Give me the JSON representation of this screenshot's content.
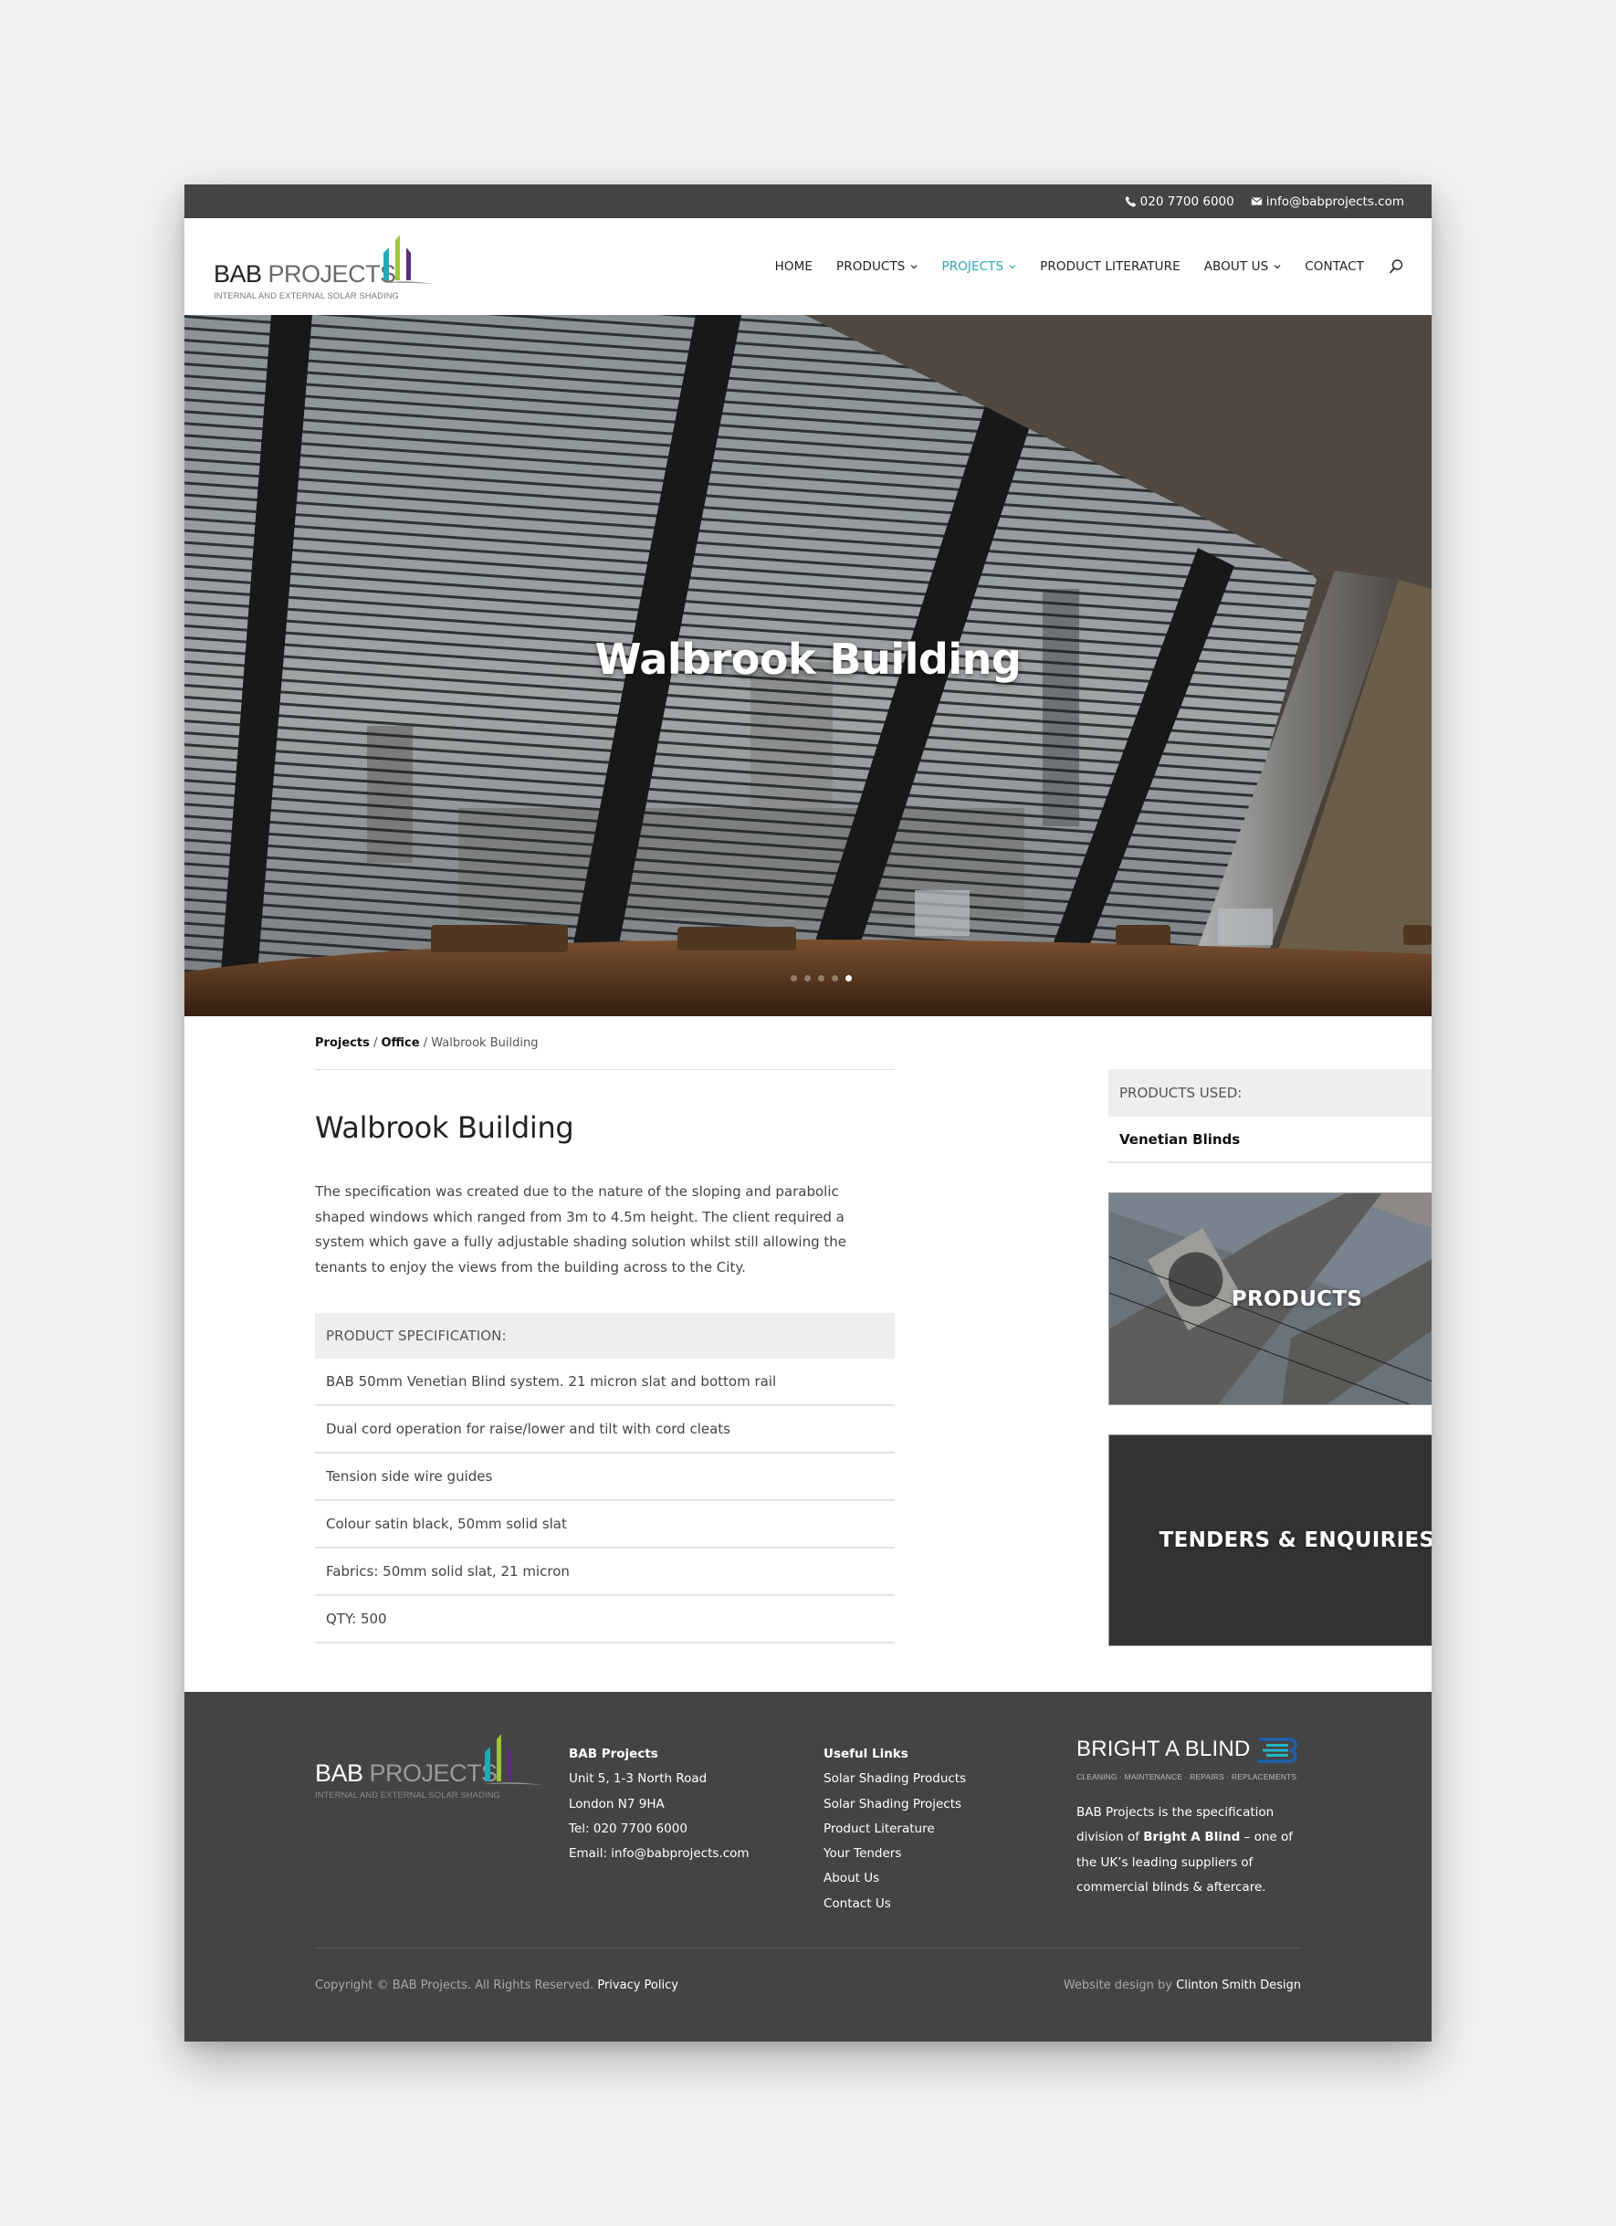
{
  "topbar": {
    "phone": "020 7700 6000",
    "email": "info@babprojects.com",
    "phone_icon": "phone-icon",
    "email_icon": "envelope-icon"
  },
  "logo": {
    "word_bab": "BAB",
    "word_projects": "PROJECTS",
    "tagline": "INTERNAL AND EXTERNAL SOLAR SHADING",
    "bar_colors": [
      "#23a7b9",
      "#9fc63b",
      "#5c2d7e"
    ]
  },
  "nav": {
    "items": [
      {
        "label": "HOME",
        "dropdown": false,
        "active": false
      },
      {
        "label": "PRODUCTS",
        "dropdown": true,
        "active": false
      },
      {
        "label": "PROJECTS",
        "dropdown": true,
        "active": true
      },
      {
        "label": "PRODUCT LITERATURE",
        "dropdown": false,
        "active": false
      },
      {
        "label": "ABOUT US",
        "dropdown": true,
        "active": false
      },
      {
        "label": "CONTACT",
        "dropdown": false,
        "active": false
      }
    ],
    "search_icon": "search-icon",
    "accent_color": "#2aa6b3"
  },
  "hero": {
    "title": "Walbrook Building",
    "slides_total": 5,
    "active_slide": 5
  },
  "breadcrumb": {
    "items": [
      "Projects",
      "Office"
    ],
    "current": "Walbrook Building",
    "separator": "/"
  },
  "project": {
    "title": "Walbrook Building",
    "description": "The specification was created due to the nature of the sloping and parabolic shaped windows which ranged from 3m to 4.5m height. The client required a system which gave a fully adjustable shading solution whilst still allowing the tenants to enjoy the views from the building across to the City.",
    "spec_heading": "PRODUCT SPECIFICATION:",
    "spec_items": [
      "BAB 50mm Venetian Blind system. 21 micron slat and bottom rail",
      "Dual cord operation for raise/lower and tilt with cord cleats",
      "Tension side wire guides",
      "Colour satin black, 50mm solid slat",
      "Fabrics: 50mm solid slat, 21 micron",
      "QTY: 500"
    ]
  },
  "sidebar": {
    "products_used_heading": "PRODUCTS USED:",
    "products_used": [
      "Venetian Blinds"
    ],
    "tiles": [
      {
        "label": "PRODUCTS"
      },
      {
        "label": "TENDERS & ENQUIRIES"
      }
    ]
  },
  "footer": {
    "company": {
      "heading": "BAB Projects",
      "lines": [
        "Unit 5, 1-3 North Road",
        "London N7 9HA",
        "Tel: 020 7700 6000",
        "Email: info@babprojects.com"
      ]
    },
    "links": {
      "heading": "Useful Links",
      "items": [
        "Solar Shading Products",
        "Solar Shading Projects",
        "Product Literature",
        "Your Tenders",
        "About Us",
        "Contact Us"
      ]
    },
    "partner": {
      "logo_name": "BRIGHT A BLIND",
      "logo_tagline": "CLEANING · MAINTENANCE · REPAIRS · REPLACEMENTS",
      "about_before": "BAB Projects is the specification division of ",
      "about_bold": "Bright A Blind",
      "about_after": " – one of the UK’s leading suppliers of commercial blinds & aftercare."
    },
    "copyright": "Copyright © BAB Projects. All Rights Reserved.",
    "privacy_link": "Privacy Policy",
    "credit_prefix": "Website design by",
    "credit_link": "Clinton Smith Design"
  }
}
